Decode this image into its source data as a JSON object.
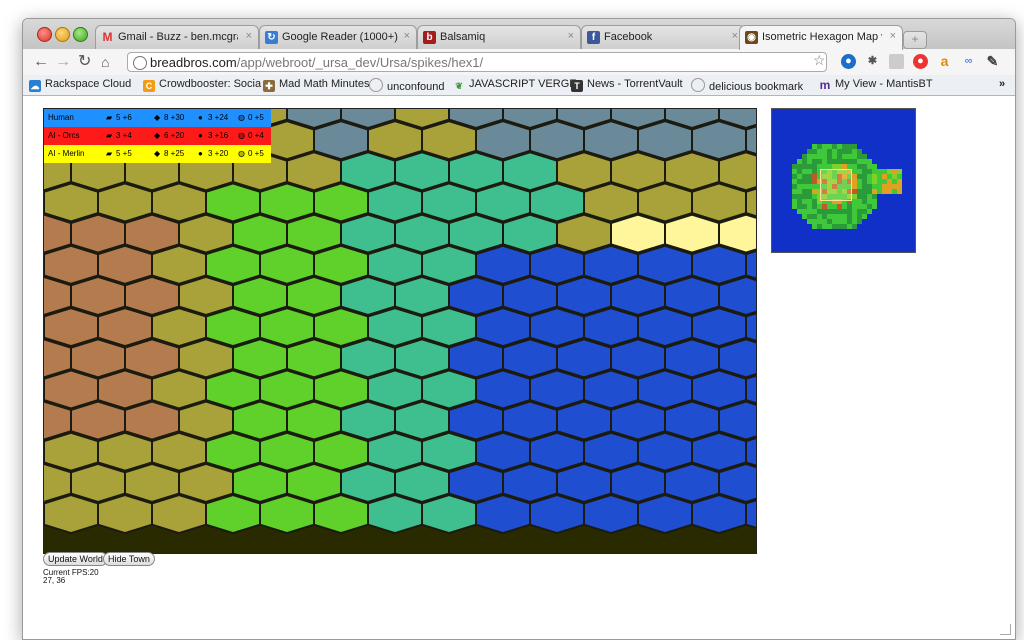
{
  "browser": {
    "tabs": [
      {
        "label": "Gmail - Buzz - ben.mcgraw",
        "icon": "gmail-icon"
      },
      {
        "label": "Google Reader (1000+)",
        "icon": "google-reader-icon"
      },
      {
        "label": "Balsamiq",
        "icon": "balsamiq-icon"
      },
      {
        "label": "Facebook",
        "icon": "facebook-icon"
      },
      {
        "label": "Isometric Hexagon Map with",
        "icon": "owl-icon"
      }
    ],
    "url_host": "breadbros.com",
    "url_path": "/app/webroot/_ursa_dev/Ursa/spikes/hex1/",
    "bookmarks": [
      {
        "label": "Rackspace Cloud"
      },
      {
        "label": "Crowdbooster: Socia"
      },
      {
        "label": "Mad Math Minutes"
      },
      {
        "label": "unconfound"
      },
      {
        "label": "JAVASCRIPT VERGE"
      },
      {
        "label": "News - TorrentVault"
      },
      {
        "label": "delicious bookmark"
      },
      {
        "label": "My View - MantisBT"
      }
    ],
    "overflow": "»"
  },
  "hud": {
    "rows": [
      {
        "name": "Human",
        "color": "#1e90ff",
        "stats": [
          "5 +6",
          "8 +30",
          "3 +24",
          "0 +5"
        ]
      },
      {
        "name": "AI - Orcs",
        "color": "#ff1a1a",
        "stats": [
          "3 +4",
          "6 +20",
          "3 +16",
          "0 +4"
        ]
      },
      {
        "name": "AI - Merlin",
        "color": "#ffff00",
        "stats": [
          "5 +5",
          "8 +25",
          "3 +20",
          "0 +5"
        ]
      }
    ]
  },
  "controls": {
    "update_world": "Update World",
    "hide_town": "Hide Town",
    "fps": "Current FPS:20",
    "coords": "27, 36"
  },
  "colors": {
    "water": "#1f4fd0",
    "grass": "#5fd12a",
    "forest": "#3fbf8f",
    "mountain_dirt": "#b47b4f",
    "hills": "#a9a23a",
    "sand": "#fff59a",
    "rock": "#6b8a99"
  }
}
